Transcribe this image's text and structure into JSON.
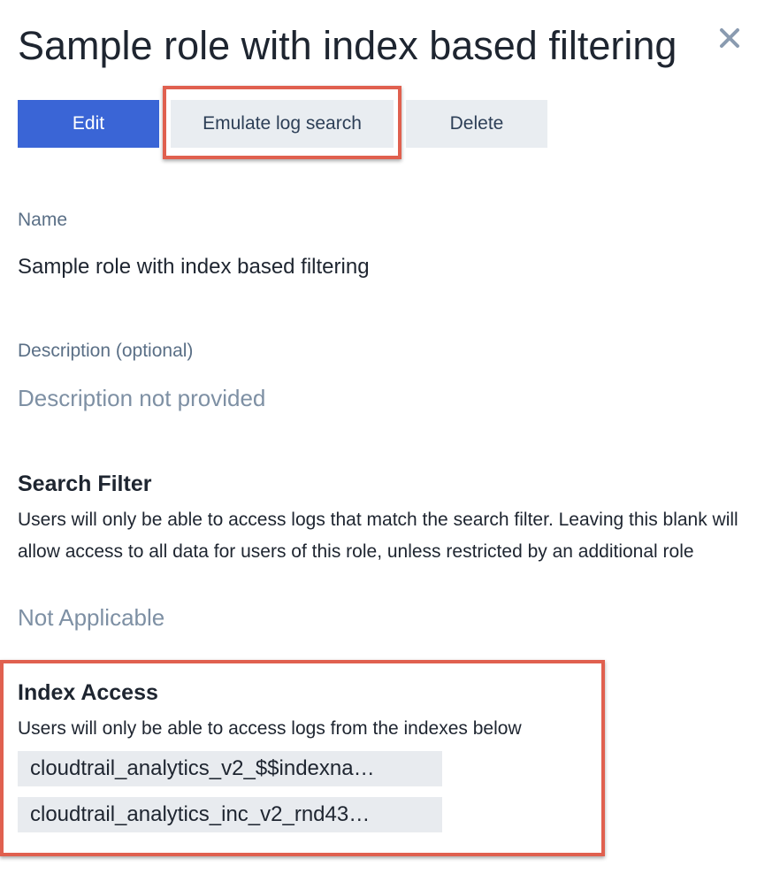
{
  "panel": {
    "title": "Sample role with index based filtering",
    "close_icon": "close-icon"
  },
  "actions": {
    "edit_label": "Edit",
    "emulate_label": "Emulate log search",
    "delete_label": "Delete"
  },
  "fields": {
    "name_label": "Name",
    "name_value": "Sample role with index based filtering",
    "description_label": "Description (optional)",
    "description_value": "Description not provided"
  },
  "search_filter": {
    "title": "Search Filter",
    "description": "Users will only be able to access logs that match the search filter. Leaving this blank will allow access to all data for users of this role, unless restricted by an additional role",
    "value": "Not Applicable"
  },
  "index_access": {
    "title": "Index Access",
    "description": "Users will only be able to access logs from the indexes below",
    "indexes": [
      "cloudtrail_analytics_v2_$$indexna…",
      "cloudtrail_analytics_inc_v2_rnd43…"
    ]
  },
  "colors": {
    "primary": "#3a65d6",
    "secondary_button": "#e9edf1",
    "highlight": "#e0604f",
    "muted_text": "#7e90a4"
  }
}
